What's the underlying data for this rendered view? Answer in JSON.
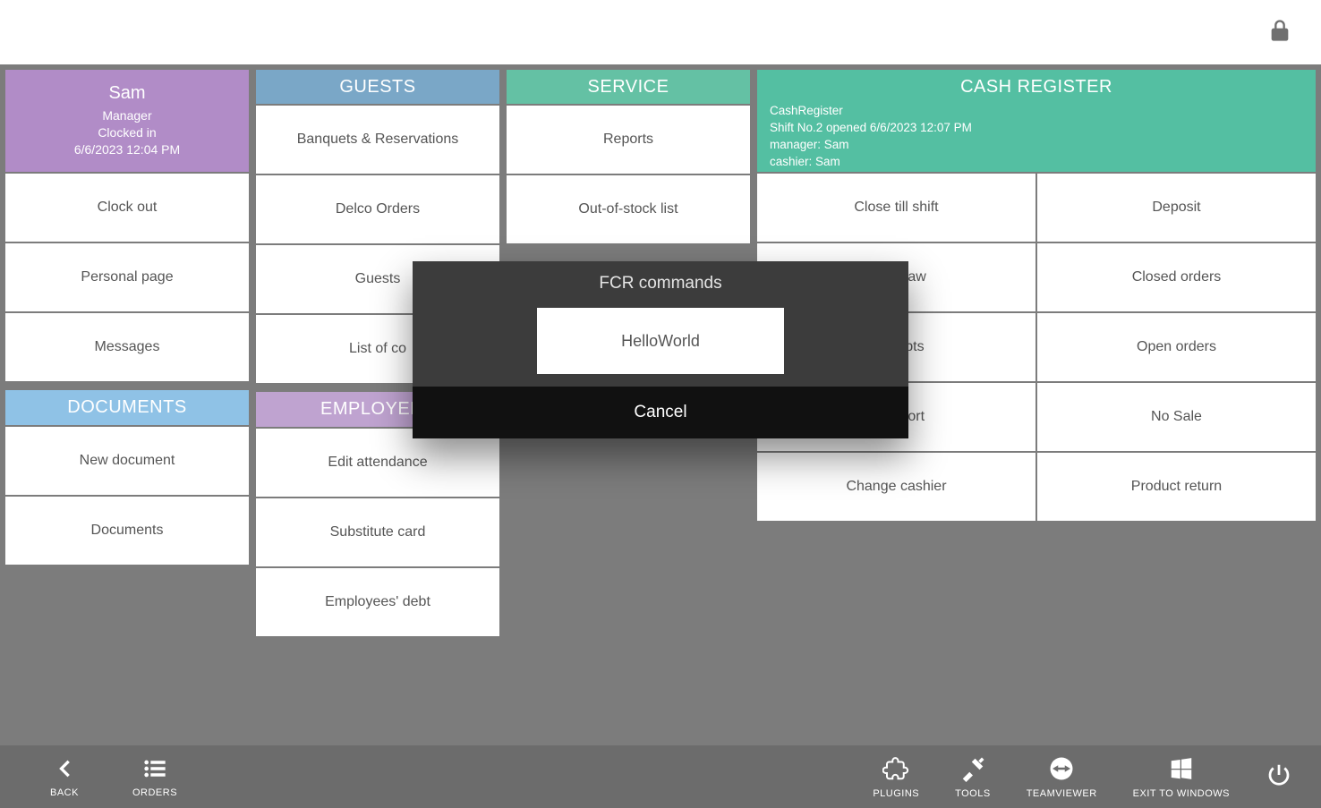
{
  "user": {
    "name": "Sam",
    "role": "Manager",
    "status": "Clocked in",
    "timestamp": "6/6/2023 12:04 PM"
  },
  "user_menu": {
    "clock_out": "Clock out",
    "personal_page": "Personal page",
    "messages": "Messages"
  },
  "documents": {
    "title": "DOCUMENTS",
    "new_document": "New document",
    "documents": "Documents"
  },
  "guests": {
    "title": "GUESTS",
    "banquets": "Banquets & Reservations",
    "delco": "Delco Orders",
    "guests": "Guests",
    "list_of_co": "List of co"
  },
  "employees": {
    "title": "EMPLOYEES",
    "edit_attendance": "Edit attendance",
    "substitute_card": "Substitute card",
    "employees_debt": "Employees' debt"
  },
  "service": {
    "title": "SERVICE",
    "reports": "Reports",
    "out_of_stock": "Out-of-stock list"
  },
  "cash_register": {
    "title": "CASH REGISTER",
    "register_name": "CashRegister",
    "shift_line": "Shift No.2 opened 6/6/2023 12:07 PM",
    "manager_line": "manager: Sam",
    "cashier_line": "cashier: Sam",
    "close_till": "Close till shift",
    "deposit": "Deposit",
    "withdraw": "Withdraw",
    "closed_orders": "Closed orders",
    "receipts": "Receipts",
    "open_orders": "Open orders",
    "x_report": "X Report",
    "no_sale": "No Sale",
    "change_cashier": "Change cashier",
    "product_return": "Product return"
  },
  "modal": {
    "title": "FCR commands",
    "option": "HelloWorld",
    "cancel": "Cancel"
  },
  "footer": {
    "back": "BACK",
    "orders": "ORDERS",
    "plugins": "PLUGINS",
    "tools": "TOOLS",
    "teamviewer": "TEAMVIEWER",
    "exit": "EXIT TO WINDOWS"
  }
}
